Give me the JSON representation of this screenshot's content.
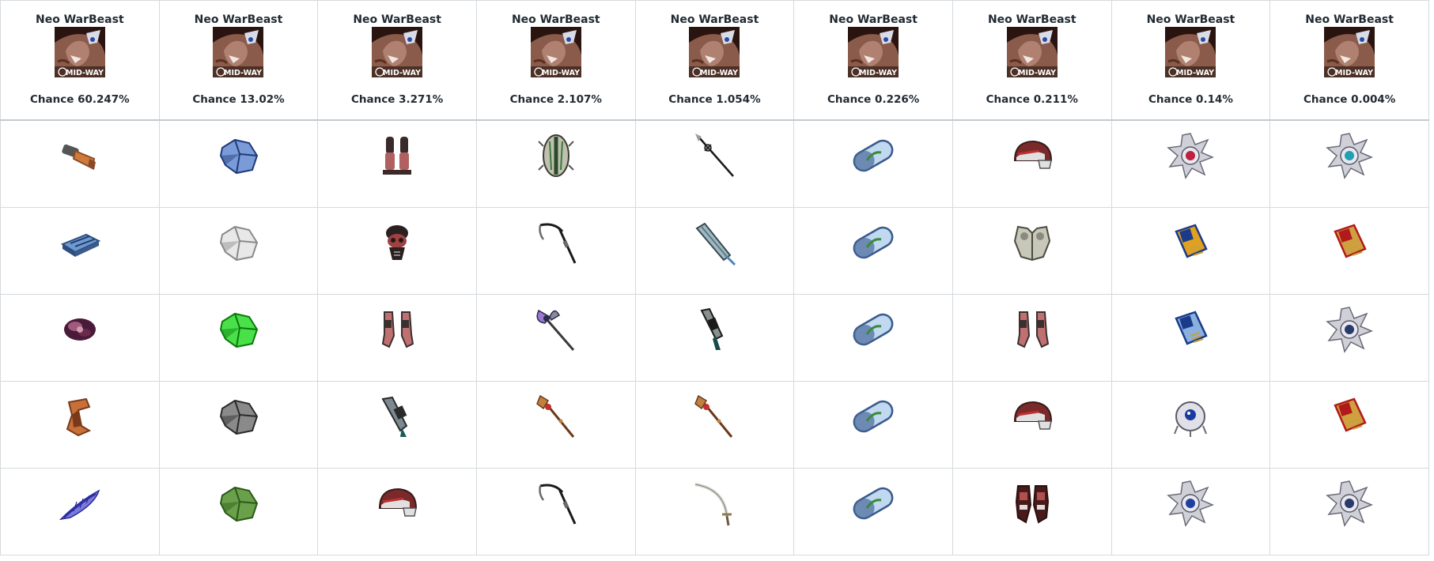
{
  "monster": {
    "name": "Neo WarBeast",
    "portrait_icon": "warbeast-portrait-icon",
    "portrait_watermark": "MID-WAY"
  },
  "chance_prefix": "Chance",
  "columns": [
    {
      "chance": "60.247%",
      "items": [
        {
          "icon": "copper-gauntlet-icon",
          "colors": [
            "#8a4a2a",
            "#d07a3a"
          ]
        },
        {
          "icon": "steel-ingot-icon",
          "colors": [
            "#2e4e7e",
            "#6e9ad0"
          ]
        },
        {
          "icon": "dark-flower-gem-icon",
          "colors": [
            "#4a1a3a",
            "#a05a7a"
          ]
        },
        {
          "icon": "copper-scroll-icon",
          "colors": [
            "#7a3a1a",
            "#c8703a"
          ]
        },
        {
          "icon": "blue-feather-icon",
          "colors": [
            "#2a2aa0",
            "#7a7ad8"
          ]
        }
      ]
    },
    {
      "chance": "13.02%",
      "items": [
        {
          "icon": "blue-ore-icon",
          "colors": [
            "#1e3a7a",
            "#7a9ad8"
          ]
        },
        {
          "icon": "white-ore-icon",
          "colors": [
            "#8a8a8a",
            "#e8e8e8"
          ]
        },
        {
          "icon": "green-ore-icon",
          "colors": [
            "#0a7a0a",
            "#4ae04a"
          ]
        },
        {
          "icon": "grey-ore-icon",
          "colors": [
            "#2a2a2a",
            "#8a8a8a"
          ]
        },
        {
          "icon": "dark-green-ore-icon",
          "colors": [
            "#2a5a1a",
            "#6aa04a"
          ]
        }
      ]
    },
    {
      "chance": "3.271%",
      "items": [
        {
          "icon": "red-greaves-icon",
          "colors": [
            "#3a2a2a",
            "#b06060"
          ]
        },
        {
          "icon": "skull-armor-icon",
          "colors": [
            "#2a2020",
            "#a04040"
          ]
        },
        {
          "icon": "arm-guards-icon",
          "colors": [
            "#3a3030",
            "#c07070"
          ]
        },
        {
          "icon": "arm-cannon-icon",
          "colors": [
            "#2a2a2a",
            "#7a8a90"
          ]
        },
        {
          "icon": "red-helmet-icon",
          "colors": [
            "#7a2a2a",
            "#e0e0e0"
          ]
        }
      ]
    },
    {
      "chance": "2.107%",
      "items": [
        {
          "icon": "green-shield-icon",
          "colors": [
            "#2a4a2a",
            "#c0c0b0"
          ]
        },
        {
          "icon": "scythe-icon",
          "colors": [
            "#1a1a1a",
            "#6a6a6a"
          ]
        },
        {
          "icon": "battle-axe-icon",
          "colors": [
            "#2a2a4a",
            "#9a7ad0"
          ]
        },
        {
          "icon": "ornate-staff-icon",
          "colors": [
            "#6a3a1a",
            "#c08040"
          ]
        },
        {
          "icon": "scythe-icon",
          "colors": [
            "#1a1a1a",
            "#6a6a6a"
          ]
        }
      ]
    },
    {
      "chance": "1.054%",
      "items": [
        {
          "icon": "spear-icon",
          "colors": [
            "#1a1a1a",
            "#9a9a9a"
          ]
        },
        {
          "icon": "great-sword-icon",
          "colors": [
            "#3a4a50",
            "#a0b8c0"
          ]
        },
        {
          "icon": "blaster-gun-icon",
          "colors": [
            "#1a1a1a",
            "#8a9090"
          ]
        },
        {
          "icon": "ornate-staff-icon",
          "colors": [
            "#6a3a1a",
            "#c08040"
          ]
        },
        {
          "icon": "curved-sabre-icon",
          "colors": [
            "#7a7a7a",
            "#d8d8d0"
          ]
        }
      ]
    },
    {
      "chance": "0.226%",
      "items": [
        {
          "icon": "capsule-icon",
          "colors": [
            "#3a5a8a",
            "#c0d8f0"
          ]
        },
        {
          "icon": "capsule-icon",
          "colors": [
            "#3a5a8a",
            "#c0d8f0"
          ]
        },
        {
          "icon": "capsule-icon",
          "colors": [
            "#3a5a8a",
            "#c0d8f0"
          ]
        },
        {
          "icon": "capsule-icon",
          "colors": [
            "#3a5a8a",
            "#c0d8f0"
          ]
        },
        {
          "icon": "capsule-icon",
          "colors": [
            "#3a5a8a",
            "#c0d8f0"
          ]
        }
      ]
    },
    {
      "chance": "0.211%",
      "items": [
        {
          "icon": "red-helmet-icon",
          "colors": [
            "#7a2a2a",
            "#e0e0e0"
          ]
        },
        {
          "icon": "grey-chest-armor-icon",
          "colors": [
            "#4a4a40",
            "#c8c8b8"
          ]
        },
        {
          "icon": "arm-guards-icon",
          "colors": [
            "#3a3030",
            "#c07070"
          ]
        },
        {
          "icon": "red-helmet-icon",
          "colors": [
            "#7a2a2a",
            "#e0e0e0"
          ]
        },
        {
          "icon": "red-boots-icon",
          "colors": [
            "#4a1a1a",
            "#b05050"
          ]
        }
      ]
    },
    {
      "chance": "0.14%",
      "items": [
        {
          "icon": "red-gem-orb-icon",
          "colors": [
            "#c02040",
            "#d0d0d8"
          ]
        },
        {
          "icon": "gold-chip-card-icon",
          "colors": [
            "#1a3a8a",
            "#e0a020"
          ]
        },
        {
          "icon": "blue-chip-card-icon",
          "colors": [
            "#1a3a8a",
            "#8ab0e0"
          ]
        },
        {
          "icon": "blue-eye-orb-icon",
          "colors": [
            "#1a3aa0",
            "#e0e0e8"
          ]
        },
        {
          "icon": "blue-gem-orb-icon",
          "colors": [
            "#2040a0",
            "#d0d0d8"
          ]
        }
      ]
    },
    {
      "chance": "0.004%",
      "items": [
        {
          "icon": "cyan-gem-orb-icon",
          "colors": [
            "#20a0b0",
            "#d0d0d8"
          ]
        },
        {
          "icon": "red-chip-card-icon",
          "colors": [
            "#b01a1a",
            "#d0a040"
          ]
        },
        {
          "icon": "silver-gem-orb-icon",
          "colors": [
            "#2a3a6a",
            "#d0d0d8"
          ]
        },
        {
          "icon": "red-chip-card-icon",
          "colors": [
            "#b01a1a",
            "#d0a040"
          ]
        },
        {
          "icon": "silver-gem-orb-icon",
          "colors": [
            "#2a3a6a",
            "#d0d0d8"
          ]
        }
      ]
    }
  ]
}
